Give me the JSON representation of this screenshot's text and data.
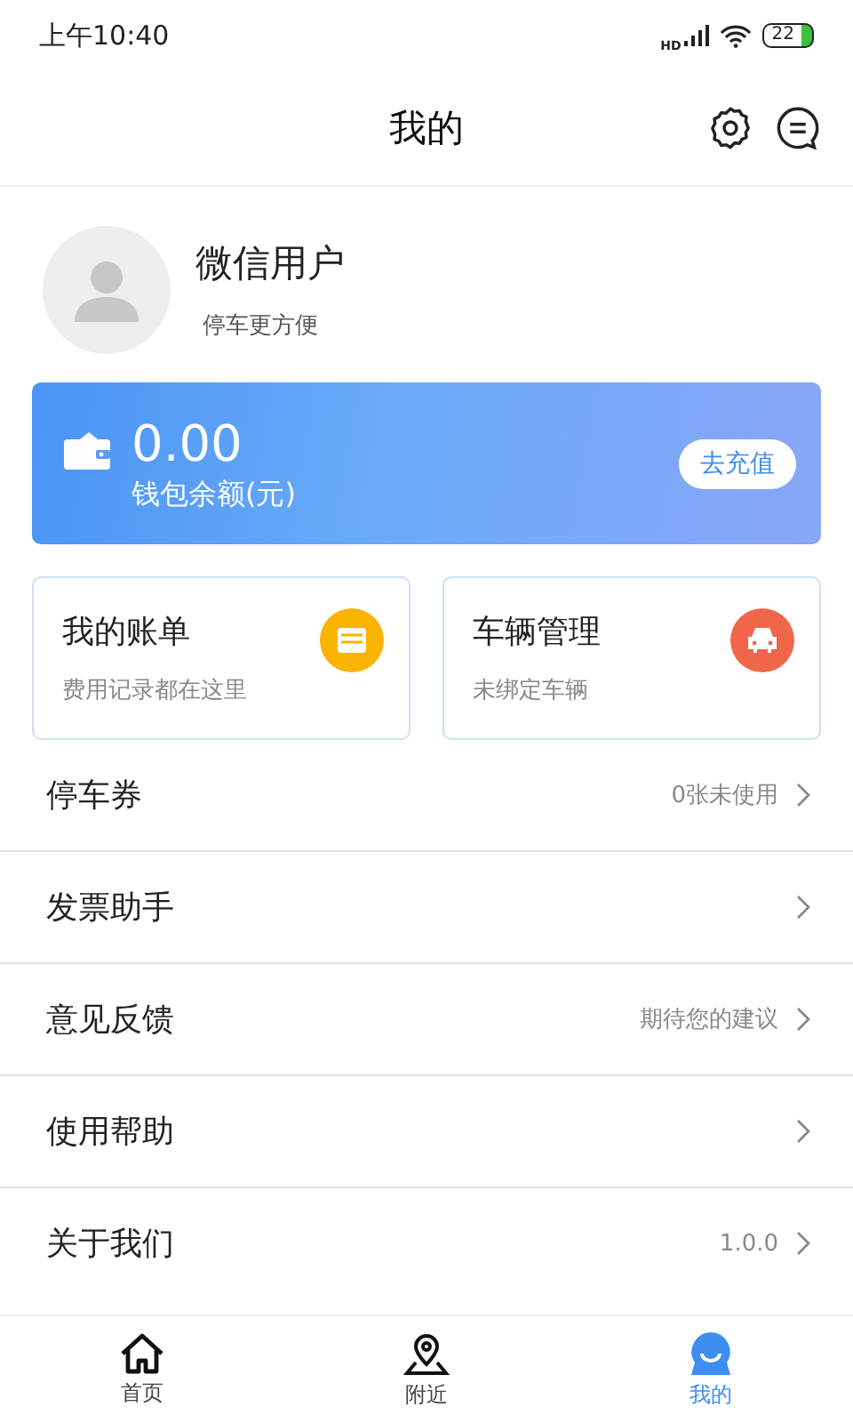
{
  "status_bar": {
    "time": "上午10:40",
    "network": "HD",
    "battery": "22"
  },
  "header": {
    "title": "我的"
  },
  "profile": {
    "name": "微信用户",
    "subtitle": "停车更方便"
  },
  "wallet": {
    "amount": "0.00",
    "label": "钱包余额(元)",
    "button": "去充值"
  },
  "cards": [
    {
      "kind": "bill",
      "title": "我的账单",
      "subtitle": "费用记录都在这里",
      "color": "#f8b400"
    },
    {
      "kind": "car",
      "title": "车辆管理",
      "subtitle": "未绑定车辆",
      "color": "#f0664a"
    }
  ],
  "menu": [
    {
      "label": "停车券",
      "value": "0张未使用"
    },
    {
      "label": "发票助手"
    },
    {
      "label": "意见反馈",
      "value": "期待您的建议"
    },
    {
      "label": "使用帮助"
    },
    {
      "label": "关于我们",
      "value": "1.0.0"
    }
  ],
  "tabs": [
    {
      "kind": "home",
      "label": "首页",
      "selected": false
    },
    {
      "kind": "nearby",
      "label": "附近",
      "selected": false
    },
    {
      "kind": "me",
      "label": "我的",
      "selected": true
    }
  ]
}
